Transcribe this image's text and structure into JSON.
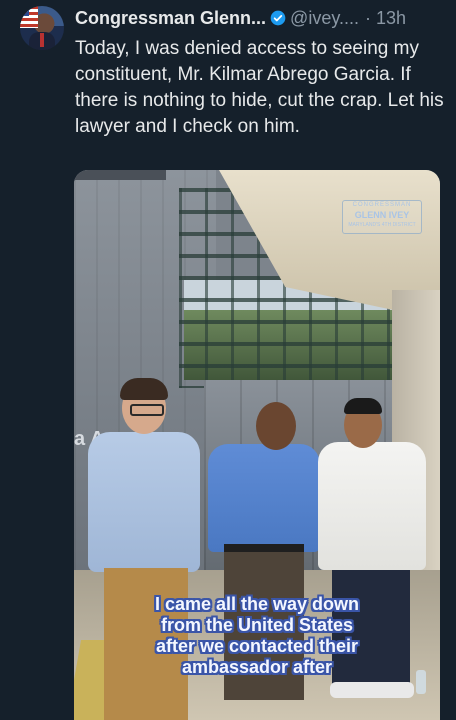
{
  "tweet": {
    "author": {
      "name": "Congressman Glenn...",
      "handle": "@ivey....",
      "time": "· 13h",
      "verified_color": "#1d9bf0"
    },
    "text": "Today, I was denied access to seeing my constituent, Mr. Kilmar Abrego Garcia. If there is nothing to hide, cut the crap. Let his lawyer and I check on him.",
    "media": {
      "watermark": {
        "line1": "CONGRESSMAN",
        "line2": "GLENN IVEY",
        "line3": "MARYLAND'S 4TH DISTRICT"
      },
      "wall_text": "a A",
      "caption_lines": [
        "I came all the way down",
        "from the United States",
        "after we contacted their",
        "ambassador after"
      ]
    }
  },
  "colors": {
    "background": "#15202b",
    "text": "#e7e9ea",
    "secondary_text": "#8b98a5",
    "caption_outline": "#3a55a8"
  }
}
